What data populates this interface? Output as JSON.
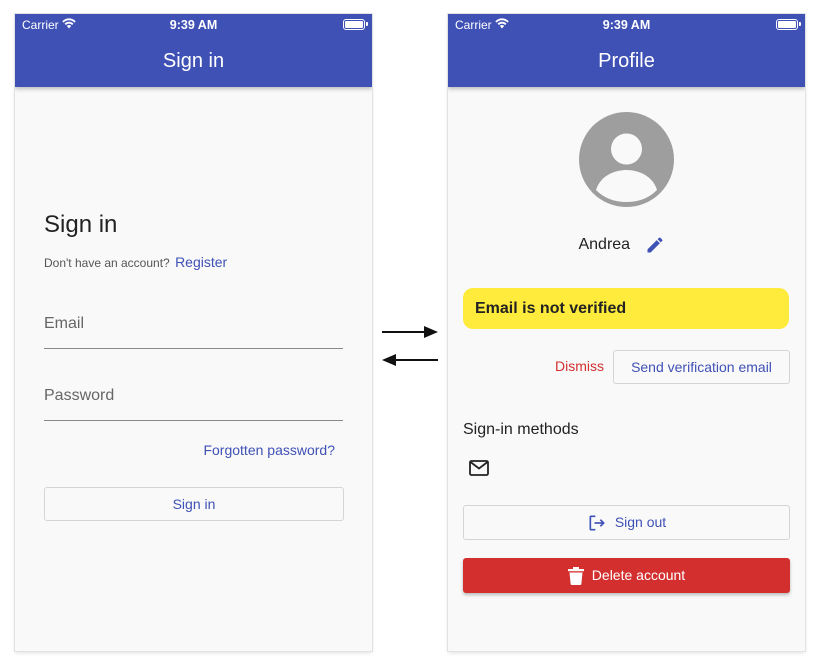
{
  "colors": {
    "appbar": "#3f51b5",
    "primary": "#3f51b5",
    "danger": "#d32f2f",
    "warning": "#ffeb3b",
    "background": "#f9f9f9"
  },
  "status_bar": {
    "carrier": "Carrier",
    "time": "9:39 AM",
    "wifi_icon": "wifi-icon",
    "battery_icon": "battery-icon"
  },
  "signin_screen": {
    "appbar_title": "Sign in",
    "heading": "Sign in",
    "no_account_text": "Don't have an account?",
    "register_link": "Register",
    "email_placeholder": "Email",
    "email_value": "",
    "password_placeholder": "Password",
    "password_value": "",
    "forgot_password": "Forgotten password?",
    "signin_button": "Sign in"
  },
  "transition_arrows": [
    "arrow-right-icon",
    "arrow-left-icon"
  ],
  "profile_screen": {
    "appbar_title": "Profile",
    "avatar_icon": "account-circle-icon",
    "display_name": "Andrea",
    "edit_icon": "pencil-icon",
    "verification_banner": "Email is not verified",
    "dismiss_button": "Dismiss",
    "send_verification_button": "Send verification email",
    "signin_methods_title": "Sign-in methods",
    "signin_methods": [
      "mail-icon"
    ],
    "signout_button": "Sign out",
    "signout_icon": "logout-icon",
    "delete_button": "Delete account",
    "delete_icon": "trash-icon"
  }
}
